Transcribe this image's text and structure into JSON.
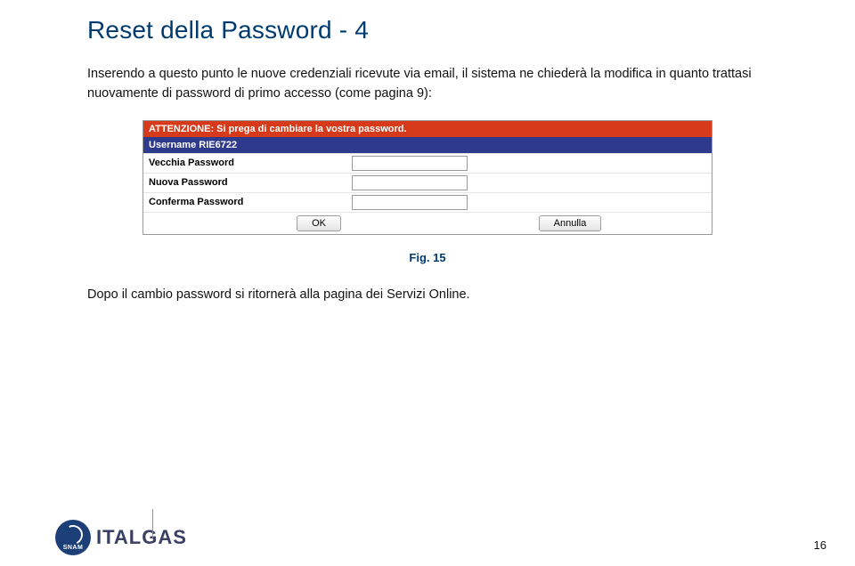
{
  "title": "Reset della Password - 4",
  "intro": "Inserendo a questo punto le nuove credenziali ricevute via email, il sistema ne chiederà la modifica in quanto trattasi nuovamente di password di primo accesso (come pagina 9):",
  "form": {
    "alert": "ATTENZIONE: Si prega di cambiare la vostra password.",
    "username_label": "Username",
    "username_value": "RIE6722",
    "old_pw_label": "Vecchia Password",
    "new_pw_label": "Nuova Password",
    "confirm_pw_label": "Conferma Password",
    "ok_btn": "OK",
    "cancel_btn": "Annulla"
  },
  "figure_caption": "Fig. 15",
  "after": "Dopo il cambio password si ritornerà alla pagina dei Servizi Online.",
  "page_number": "16",
  "logo": {
    "snam": "SNAM",
    "italgas": "ITALGAS"
  }
}
